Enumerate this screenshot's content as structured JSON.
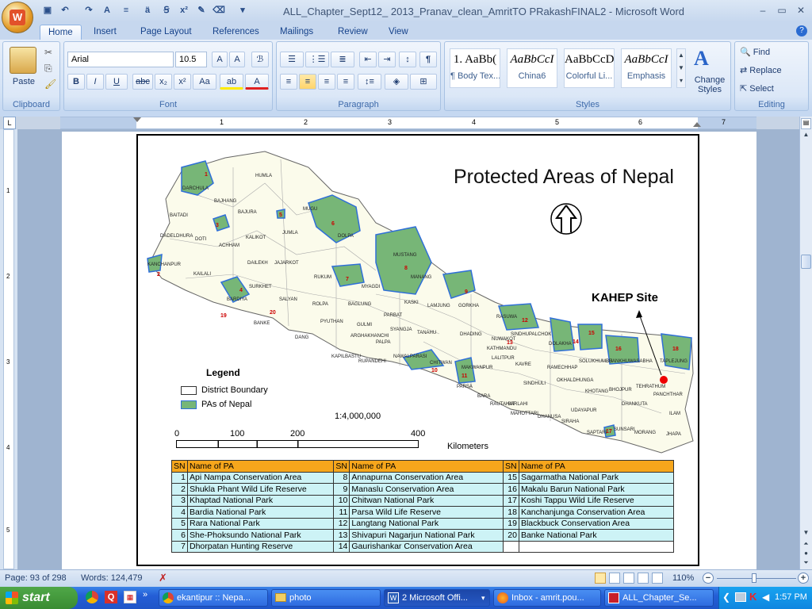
{
  "window": {
    "title": "ALL_Chapter_Sept12_ 2013_Pranav_clean_AmritTO PRakashFINAL2 - Microsoft Word"
  },
  "tabs": [
    "Home",
    "Insert",
    "Page Layout",
    "References",
    "Mailings",
    "Review",
    "View"
  ],
  "ribbon": {
    "clipboard": {
      "label": "Clipboard",
      "paste": "Paste"
    },
    "font": {
      "label": "Font",
      "name": "Arial",
      "size": "10.5"
    },
    "paragraph": {
      "label": "Paragraph"
    },
    "styles": {
      "label": "Styles",
      "items": [
        {
          "preview": "1. AaBb(",
          "name": "¶ Body Tex..."
        },
        {
          "preview": "AaBbCcI",
          "name": "China6"
        },
        {
          "preview": "AaBbCcD",
          "name": "Colorful Li..."
        },
        {
          "preview": "AaBbCcI",
          "name": "Emphasis"
        }
      ],
      "change": "Change Styles"
    },
    "editing": {
      "label": "Editing",
      "find": "Find",
      "replace": "Replace",
      "select": "Select"
    }
  },
  "ruler": {
    "h_numbers": [
      "1",
      "2",
      "3",
      "4",
      "5",
      "6",
      "7"
    ],
    "v_numbers": [
      "1",
      "2",
      "3",
      "4",
      "5",
      "6"
    ]
  },
  "map": {
    "title": "Protected Areas of Nepal",
    "site_label": "KAHEP Site",
    "legend": {
      "title": "Legend",
      "boundary": "District Boundary",
      "pa": "PAs of Nepal"
    },
    "scale_ratio": "1:4,000,000",
    "scale_ticks": [
      "0",
      "100",
      "200",
      "400"
    ],
    "scale_unit": "Kilometers",
    "districts": [
      "HUMLA",
      "DARCHULA",
      "BAJHANG",
      "BAITADI",
      "BAJURA",
      "MUGU",
      "DADELDHURA",
      "DOTI",
      "ACHHAM",
      "KALIKOT",
      "JUMLA",
      "DOLPA",
      "KANCHANPUR",
      "KAILALI",
      "DAILEKH",
      "JAJARKOT",
      "MUSTANG",
      "SURKHET",
      "RUKUM",
      "MANANG",
      "BARDIYA",
      "SALYAN",
      "ROLPA",
      "MYAGDI",
      "KASKI",
      "LAMJUNG",
      "GORKHA",
      "BANKE",
      "PYUTHAN",
      "BAGLUNG",
      "PARBAT",
      "RASUWA",
      "DANG",
      "GULMI",
      "SYANGJA",
      "TANAHU",
      "DHADING",
      "SINDHUPALCHOK",
      "DOLAKHA",
      "KAPILBASTU",
      "ARGHAKHANCHI",
      "PALPA",
      "NUWAKOT",
      "KATHMANDU",
      "LALITPUR",
      "RUPANDEHI",
      "NAWALPARASI",
      "CHITWAN",
      "MAKWANPUR",
      "KAVRE",
      "RAMECHHAP",
      "SOLUKHUMBU",
      "SANKHUWASABHA",
      "TAPLEJUNG",
      "PARSA",
      "BARA",
      "SINDHULI",
      "OKHALDHUNGA",
      "TEHRATHUM",
      "RAUTAHAT",
      "SARLAHI",
      "KHOTANG",
      "BHOJPUR",
      "PANCHTHAR",
      "MAHOTTARI",
      "DHANUSA",
      "UDAYAPUR",
      "DHANKUTA",
      "ILAM",
      "SIRAHA",
      "SAPTARI",
      "SUNSARI",
      "MORANG",
      "JHAPA"
    ],
    "pa_numbers": [
      "1",
      "2",
      "3",
      "4",
      "5",
      "6",
      "7",
      "8",
      "9",
      "10",
      "11",
      "12",
      "13",
      "14",
      "15",
      "16",
      "17",
      "18",
      "19",
      "20"
    ]
  },
  "pa_table": {
    "header": {
      "sn": "SN",
      "name": "Name of PA"
    },
    "rows": [
      [
        {
          "sn": "1",
          "name": "Api Nampa Conservation Area"
        },
        {
          "sn": "8",
          "name": "Annapurna Conservation Area"
        },
        {
          "sn": "15",
          "name": "Sagarmatha National Park"
        }
      ],
      [
        {
          "sn": "2",
          "name": "Shukla Phant Wild Life Reserve"
        },
        {
          "sn": "9",
          "name": "Manaslu Conservation Area"
        },
        {
          "sn": "16",
          "name": "Makalu Barun National Park"
        }
      ],
      [
        {
          "sn": "3",
          "name": "Khaptad National Park"
        },
        {
          "sn": "10",
          "name": "Chitwan National Park"
        },
        {
          "sn": "17",
          "name": "Koshi Tappu Wild Life Reserve"
        }
      ],
      [
        {
          "sn": "4",
          "name": "Bardia National Park"
        },
        {
          "sn": "11",
          "name": "Parsa Wild Life Reserve"
        },
        {
          "sn": "18",
          "name": "Kanchanjunga Conservation Area"
        }
      ],
      [
        {
          "sn": "5",
          "name": "Rara National Park"
        },
        {
          "sn": "12",
          "name": "Langtang National Park"
        },
        {
          "sn": "19",
          "name": "Blackbuck Conservation Area"
        }
      ],
      [
        {
          "sn": "6",
          "name": "She-Phoksundo National Park"
        },
        {
          "sn": "13",
          "name": "Shivapuri Nagarjun National Park"
        },
        {
          "sn": "20",
          "name": "Banke National Park"
        }
      ],
      [
        {
          "sn": "7",
          "name": "Dhorpatan Hunting Reserve"
        },
        {
          "sn": "14",
          "name": "Gaurishankar Conservation Area"
        },
        {
          "sn": "",
          "name": ""
        }
      ]
    ]
  },
  "status": {
    "page": "Page: 93 of 298",
    "words": "Words: 124,479",
    "zoom": "110%"
  },
  "taskbar": {
    "start": "start",
    "items": [
      "ekantipur :: Nepa...",
      "photo",
      "2 Microsoft Offi...",
      "Inbox - amrit.pou...",
      "ALL_Chapter_Se..."
    ],
    "time": "1:57 PM"
  }
}
